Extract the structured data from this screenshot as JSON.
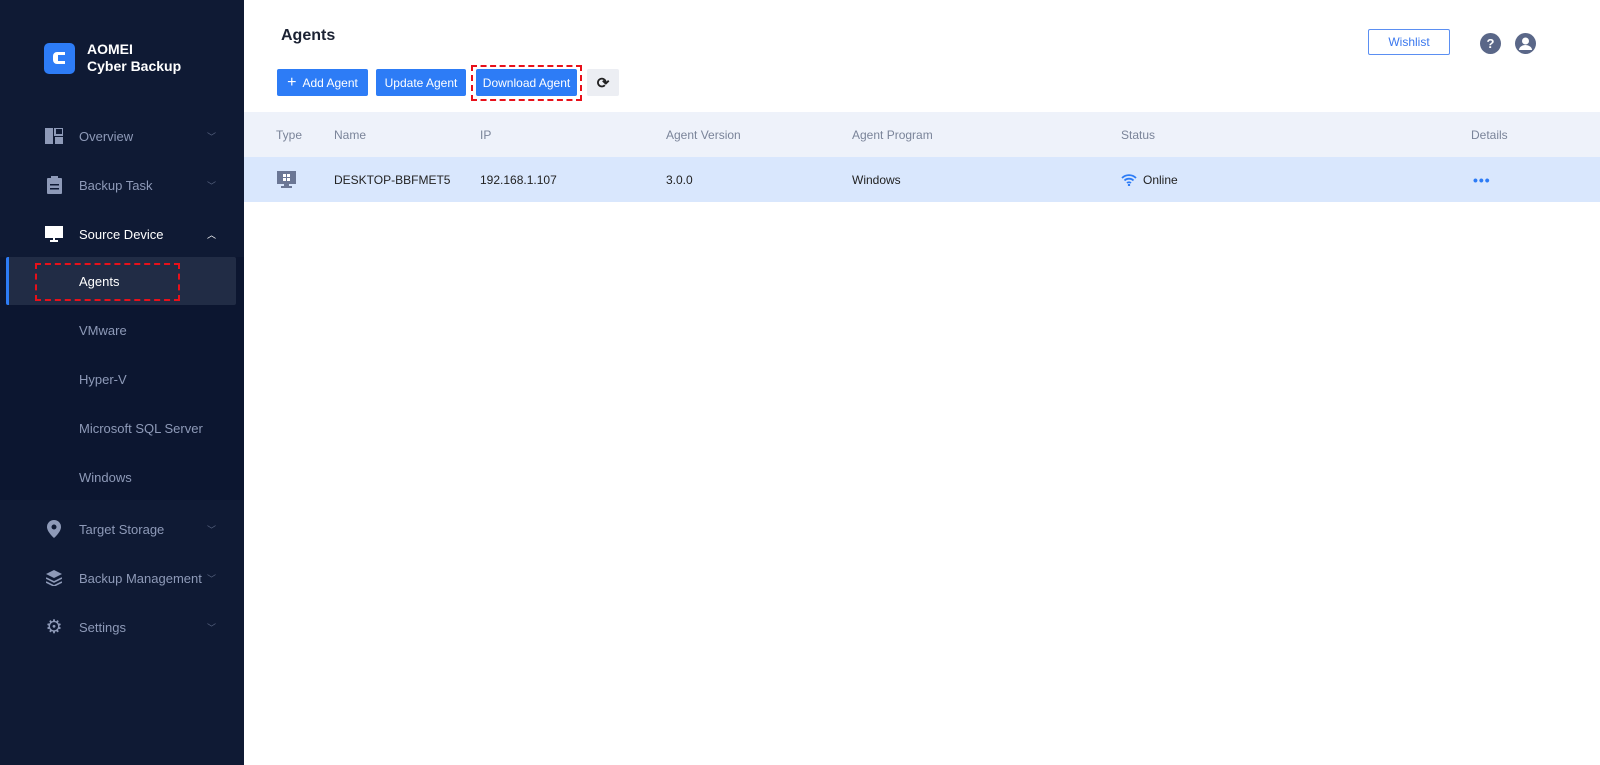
{
  "app": {
    "name_line1": "AOMEI",
    "name_line2": "Cyber Backup"
  },
  "sidebar": {
    "items": [
      {
        "label": "Overview",
        "icon": "dashboard-icon"
      },
      {
        "label": "Backup Task",
        "icon": "clipboard-icon"
      },
      {
        "label": "Source Device",
        "icon": "monitor-icon"
      },
      {
        "label": "Target Storage",
        "icon": "location-pin-icon"
      },
      {
        "label": "Backup Management",
        "icon": "layers-icon"
      },
      {
        "label": "Settings",
        "icon": "gear-icon"
      }
    ],
    "sub_items": [
      "Agents",
      "VMware",
      "Hyper-V",
      "Microsoft SQL Server",
      "Windows"
    ]
  },
  "header": {
    "title": "Agents",
    "wishlist": "Wishlist"
  },
  "toolbar": {
    "add": "Add Agent",
    "update": "Update Agent",
    "download": "Download Agent"
  },
  "table": {
    "columns": [
      "Type",
      "Name",
      "IP",
      "Agent Version",
      "Agent Program",
      "Status",
      "Details"
    ],
    "rows": [
      {
        "name": "DESKTOP-BBFMET5",
        "ip": "192.168.1.107",
        "version": "3.0.0",
        "program": "Windows",
        "status": "Online",
        "details": "•••"
      }
    ]
  },
  "colors": {
    "accent": "#2d7cf6",
    "sidebar": "#0f1a34",
    "highlight": "#e8101a"
  }
}
